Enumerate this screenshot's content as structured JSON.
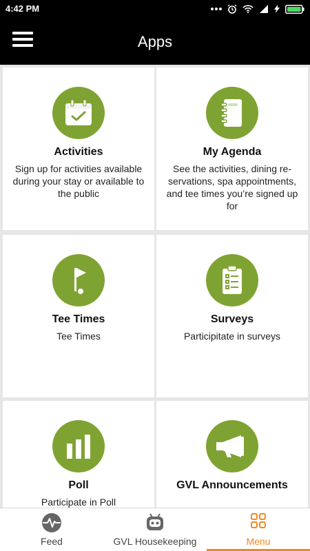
{
  "status_bar": {
    "time": "4:42 PM"
  },
  "header": {
    "title": "Apps"
  },
  "cards": [
    {
      "title": "Activities",
      "description": "Sign up for activities available during your stay or available to the public",
      "icon": "calendar-check-icon"
    },
    {
      "title": "My Agenda",
      "description": "See the activities, dining re-servations, spa appointments, and tee times you’re signed up for",
      "icon": "notebook-icon"
    },
    {
      "title": "Tee Times",
      "description": "Tee Times",
      "icon": "golf-flag-icon"
    },
    {
      "title": "Surveys",
      "description": "Participitate in surveys",
      "icon": "clipboard-list-icon"
    },
    {
      "title": "Poll",
      "description": "Participate in Poll",
      "icon": "bar-chart-icon"
    },
    {
      "title": "GVL Announcements",
      "description": "",
      "icon": "megaphone-icon"
    }
  ],
  "bottom_nav": {
    "items": [
      {
        "label": "Feed",
        "icon": "pulse-icon"
      },
      {
        "label": "GVL Housekeeping",
        "icon": "robot-icon"
      },
      {
        "label": "Menu",
        "icon": "grid-icon",
        "active": true
      }
    ]
  },
  "colors": {
    "accent_green": "#7fa332",
    "active_orange": "#f0891e",
    "header_bg": "#000000"
  }
}
